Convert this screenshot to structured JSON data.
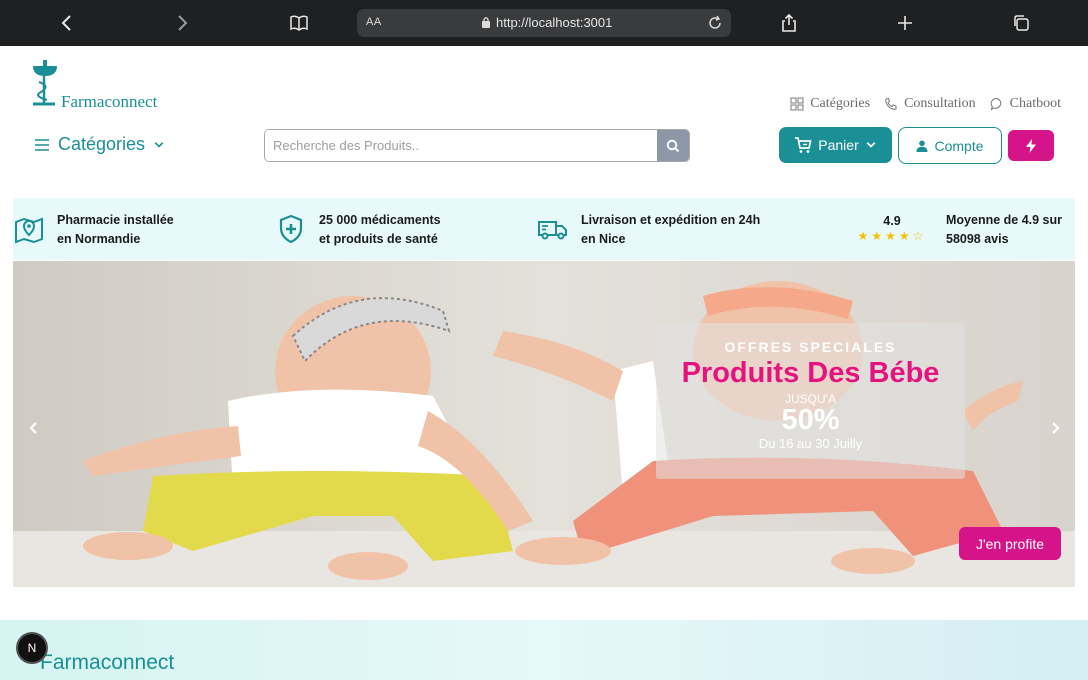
{
  "browser": {
    "text_size_label": "AA",
    "url": "http://localhost:3001"
  },
  "brand": {
    "name_part1": "Farma",
    "name_part2": "connect"
  },
  "toplinks": [
    {
      "label": "Catégories",
      "icon": "grid-icon"
    },
    {
      "label": "Consultation",
      "icon": "phone-icon"
    },
    {
      "label": "Chatboot",
      "icon": "chat-bubble-icon"
    }
  ],
  "nav": {
    "categories_label": "Catégories",
    "search_placeholder": "Recherche des Produits..",
    "cart_label": "Panier",
    "account_label": "Compte"
  },
  "info_strip": [
    {
      "line1": "Pharmacie installée",
      "line2": "en Normandie",
      "icon": "map-pin-icon"
    },
    {
      "line1": "25 000 médicaments",
      "line2": "et produits de santé",
      "icon": "shield-plus-icon"
    },
    {
      "line1": "Livraison et expédition en 24h",
      "line2": "en Nice",
      "icon": "truck-icon"
    }
  ],
  "rating": {
    "score": "4.9",
    "stars": "★★★★☆",
    "line1": "Moyenne de 4.9 sur",
    "line2": "58098 avis"
  },
  "hero": {
    "tag": "OFFRES SPECIALES",
    "title": "Produits Des Bébe",
    "upto": "JUSQU'A",
    "discount": "50%",
    "dates": "Du 16 au 30 Juilly",
    "cta": "J'en profite"
  },
  "dev_badge": "N",
  "colors": {
    "brand_teal": "#1a8f96",
    "accent_pink": "#d6148a",
    "strip_bg": "#e7f9fb"
  }
}
